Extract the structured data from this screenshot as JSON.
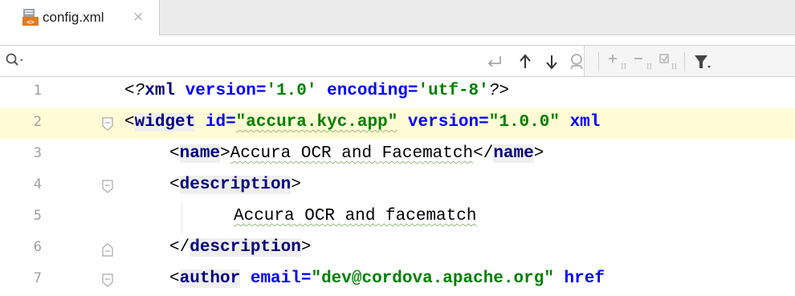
{
  "tab": {
    "filename": "config.xml",
    "close_glyph": "×",
    "icon": "xml-file-icon"
  },
  "findbar": {
    "search_value": "",
    "placeholder": "",
    "icons": [
      "search-icon",
      "enter-icon",
      "arrow-up-icon",
      "arrow-down-icon",
      "find-all-icon",
      "add-selection-icon",
      "remove-selection-icon",
      "select-all-icon",
      "filter-icon"
    ]
  },
  "editor": {
    "lines": [
      {
        "num": "1",
        "parts": [
          {
            "t": "<?",
            "c": "pi"
          },
          {
            "t": "xml",
            "c": "kw"
          },
          {
            "t": " ",
            "c": "br"
          },
          {
            "t": "version",
            "c": "attr"
          },
          {
            "t": "=",
            "c": "attr"
          },
          {
            "t": "'1.0'",
            "c": "str"
          },
          {
            "t": " ",
            "c": "br"
          },
          {
            "t": "encoding",
            "c": "attr"
          },
          {
            "t": "=",
            "c": "attr"
          },
          {
            "t": "'utf-8'",
            "c": "str"
          },
          {
            "t": "?>",
            "c": "pi"
          }
        ]
      },
      {
        "num": "2",
        "parts": [
          {
            "t": "<",
            "c": "br"
          },
          {
            "t": "widget",
            "c": "kw"
          },
          {
            "t": " ",
            "c": "br"
          },
          {
            "t": "id",
            "c": "attr"
          },
          {
            "t": "=",
            "c": "attr"
          },
          {
            "t": "\"accura.kyc.app\"",
            "c": "str"
          },
          {
            "t": " ",
            "c": "br"
          },
          {
            "t": "version",
            "c": "attr"
          },
          {
            "t": "=",
            "c": "attr"
          },
          {
            "t": "\"1.0.0\"",
            "c": "str"
          },
          {
            "t": " ",
            "c": "br"
          },
          {
            "t": "xml",
            "c": "attr"
          }
        ]
      },
      {
        "num": "3",
        "parts": [
          {
            "t": "<",
            "c": "br"
          },
          {
            "t": "name",
            "c": "kw"
          },
          {
            "t": ">",
            "c": "br"
          },
          {
            "t": "Accura OCR and Facematch",
            "c": "br"
          },
          {
            "t": "</",
            "c": "br"
          },
          {
            "t": "name",
            "c": "kw"
          },
          {
            "t": ">",
            "c": "br"
          }
        ]
      },
      {
        "num": "4",
        "parts": [
          {
            "t": "<",
            "c": "br"
          },
          {
            "t": "description",
            "c": "kw"
          },
          {
            "t": ">",
            "c": "br"
          }
        ]
      },
      {
        "num": "5",
        "parts": [
          {
            "t": "Accura OCR and facematch",
            "c": "br"
          }
        ]
      },
      {
        "num": "6",
        "parts": [
          {
            "t": "</",
            "c": "br"
          },
          {
            "t": "description",
            "c": "kw"
          },
          {
            "t": ">",
            "c": "br"
          }
        ]
      },
      {
        "num": "7",
        "parts": [
          {
            "t": "<",
            "c": "br"
          },
          {
            "t": "author",
            "c": "kw"
          },
          {
            "t": " ",
            "c": "br"
          },
          {
            "t": "email",
            "c": "attr"
          },
          {
            "t": "=",
            "c": "attr"
          },
          {
            "t": "\"dev@cordova.apache.org\"",
            "c": "str"
          },
          {
            "t": " ",
            "c": "br"
          },
          {
            "t": "href",
            "c": "attr"
          }
        ]
      }
    ]
  },
  "colors": {
    "tag": "#000080",
    "attribute": "#0000ff",
    "string": "#008000",
    "line_number": "#9e9e9e",
    "current_line": "#fffbd6"
  }
}
